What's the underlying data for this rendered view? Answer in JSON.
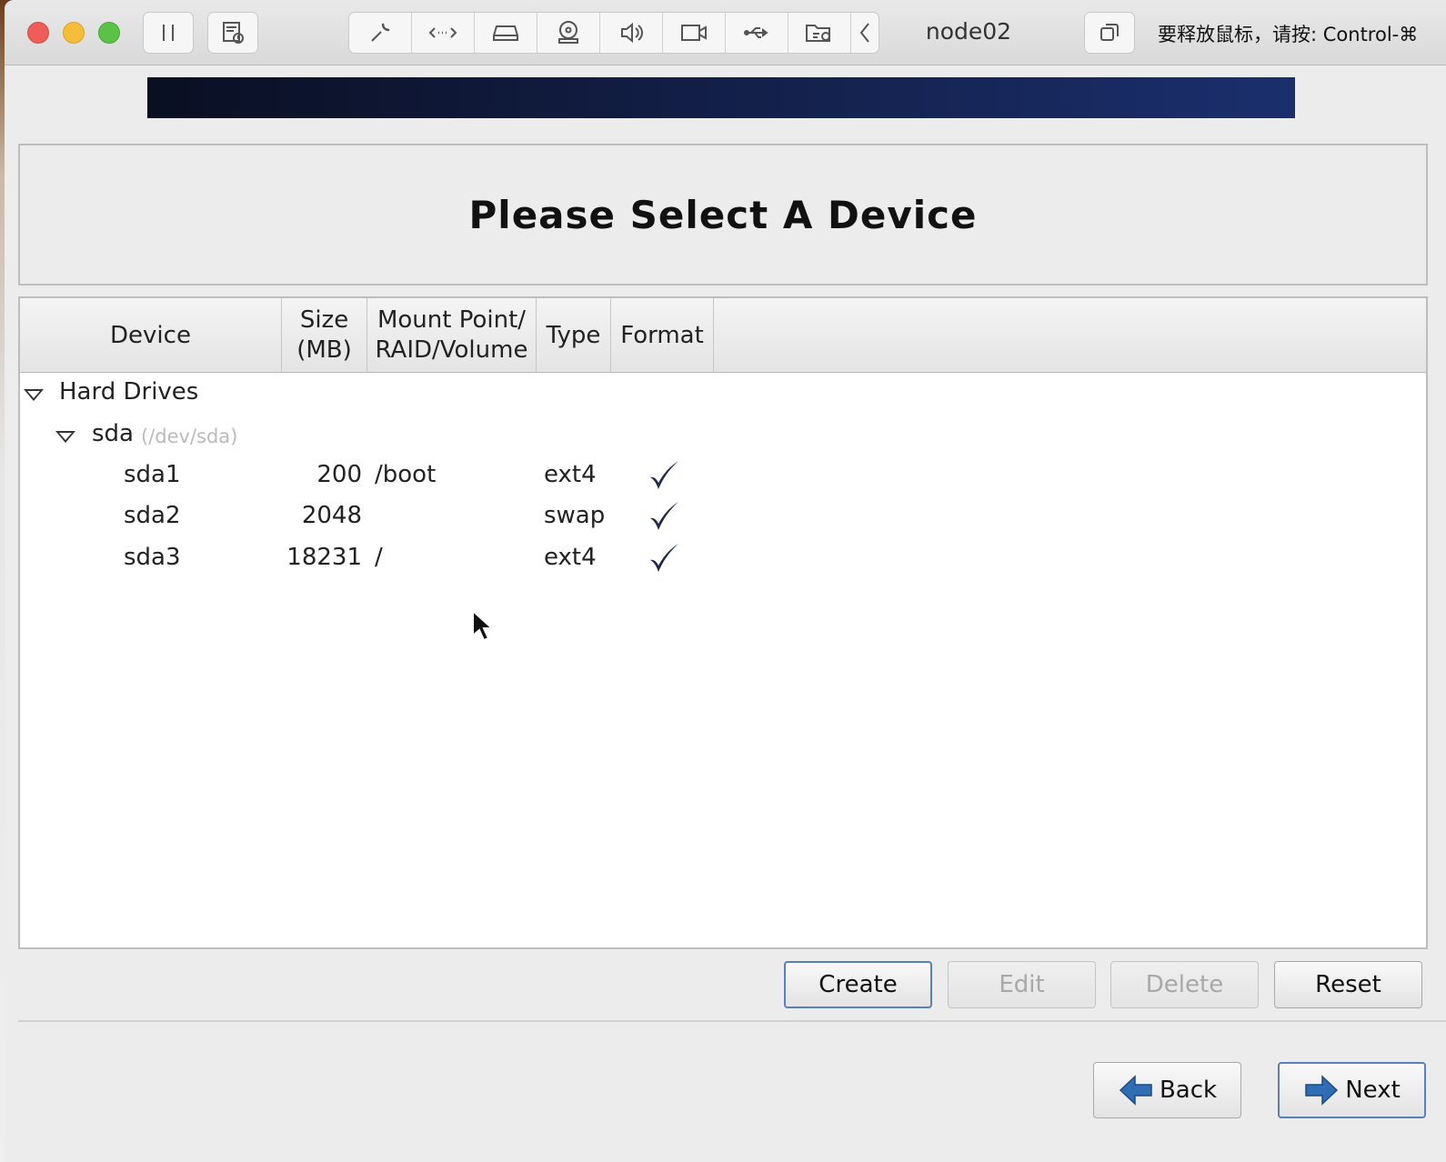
{
  "window": {
    "title": "node02",
    "release_hint": "要释放鼠标，请按: Control-⌘"
  },
  "toolbar": {
    "icons": [
      "pause-icon",
      "snapshot-icon",
      "wrench-icon",
      "network-arrows-icon",
      "hard-disk-icon",
      "cd-drive-icon",
      "speaker-icon",
      "camera-icon",
      "usb-icon",
      "shared-folder-icon",
      "chevron-left-icon",
      "fullscreen-icon"
    ]
  },
  "installer": {
    "heading": "Please Select A Device",
    "columns": [
      "Device",
      "Size\n(MB)",
      "Mount Point/\nRAID/Volume",
      "Type",
      "Format"
    ],
    "tree": {
      "group_label": "Hard Drives",
      "disk_name": "sda",
      "disk_path": "(/dev/sda)",
      "partitions": [
        {
          "device": "sda1",
          "size": "200",
          "mount": "/boot",
          "type": "ext4",
          "format": true
        },
        {
          "device": "sda2",
          "size": "2048",
          "mount": "",
          "type": "swap",
          "format": true
        },
        {
          "device": "sda3",
          "size": "18231",
          "mount": "/",
          "type": "ext4",
          "format": true
        }
      ]
    },
    "actions": {
      "create": "Create",
      "edit": "Edit",
      "delete": "Delete",
      "reset": "Reset"
    },
    "nav": {
      "back": "Back",
      "next": "Next"
    }
  },
  "colors": {
    "banner_start": "#0a0f22",
    "banner_end": "#1b2f6d",
    "nav_arrow": "#2f6db5"
  }
}
